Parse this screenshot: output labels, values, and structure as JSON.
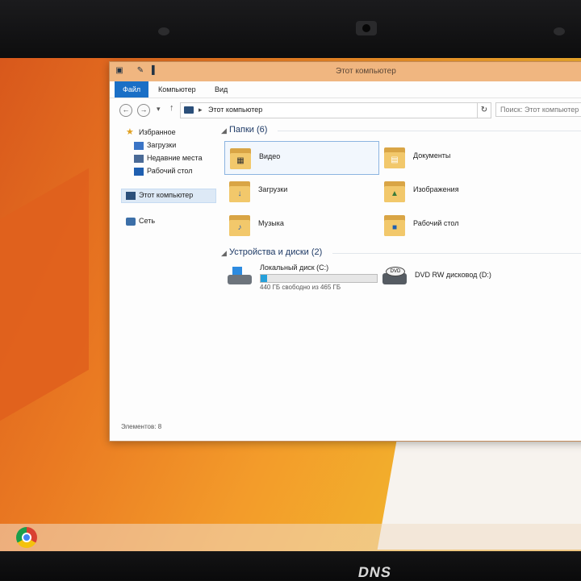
{
  "window": {
    "title": "Этот компьютер"
  },
  "ribbon": {
    "tabs": [
      "Файл",
      "Компьютер",
      "Вид"
    ]
  },
  "address": {
    "path": "Этот компьютер",
    "search_placeholder": "Поиск: Этот компьютер"
  },
  "navpane": {
    "favorites": "Избранное",
    "favorites_items": [
      "Загрузки",
      "Недавние места",
      "Рабочий стол"
    ],
    "this_pc": "Этот компьютер",
    "network": "Сеть"
  },
  "folders": {
    "header": "Папки (6)",
    "items": [
      "Видео",
      "Документы",
      "Загрузки",
      "Изображения",
      "Музыка",
      "Рабочий стол"
    ],
    "selected": "Видео"
  },
  "devices": {
    "header": "Устройства и диски (2)",
    "drives": [
      {
        "name": "Локальный диск (C:)",
        "free_text": "440 ГБ свободно из 465 ГБ",
        "used_fraction": 0.054,
        "icon": "hdd-icon"
      },
      {
        "name": "DVD RW дисковод (D:)",
        "icon": "dvd-drive-icon",
        "icon_label": "DVD"
      }
    ]
  },
  "status": {
    "items_count": "Элементов: 8"
  },
  "laptop": {
    "brand": "DNS"
  },
  "colors": {
    "accent": "#1a6fc6",
    "titlebar": "#f0b680",
    "desktop": "#f39b2a"
  }
}
